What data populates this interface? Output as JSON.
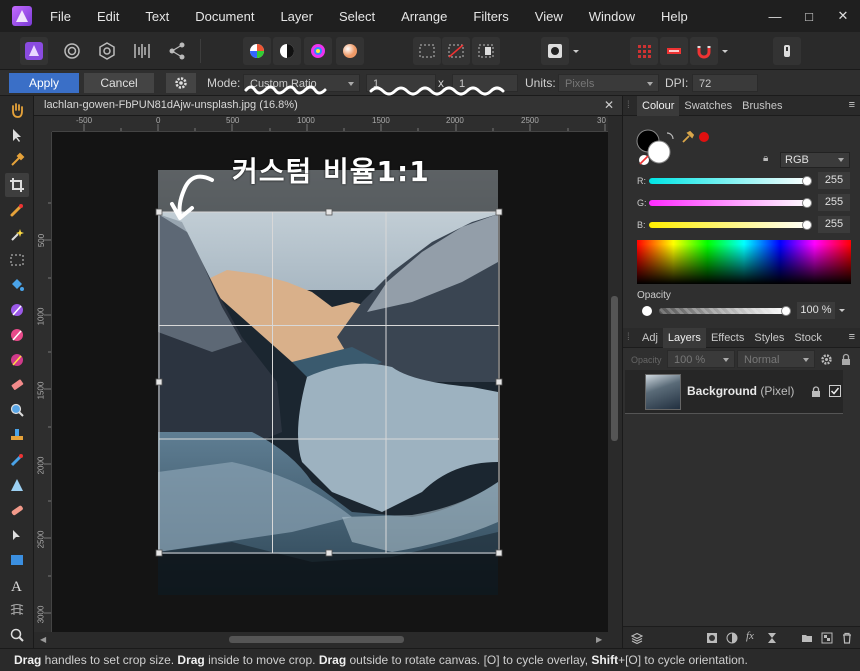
{
  "menu": [
    "File",
    "Edit",
    "Text",
    "Document",
    "Layer",
    "Select",
    "Arrange",
    "Filters",
    "View",
    "Window",
    "Help"
  ],
  "window_controls": {
    "minimize": "—",
    "restore": "□",
    "close": "✕"
  },
  "context": {
    "apply_label": "Apply",
    "cancel_label": "Cancel",
    "mode_label": "Mode:",
    "mode_value": "Custom Ratio",
    "ratio_w": "1",
    "ratio_x": "x",
    "ratio_h": "1",
    "units_label": "Units:",
    "units_value": "Pixels",
    "dpi_label": "DPI:",
    "dpi_value": "72"
  },
  "document": {
    "tab_title": "lachlan-gowen-FbPUN81dAjw-unsplash.jpg (16.8%)",
    "tab_close": "✕",
    "annotation": "커스텀 비율1:1",
    "ruler_h": [
      "-500",
      "0",
      "500",
      "1000",
      "1500",
      "2000",
      "2500",
      "30"
    ],
    "ruler_v": [
      "500",
      "1000",
      "1500",
      "2000",
      "2500",
      "3000"
    ]
  },
  "colour_panel": {
    "tabs": [
      "Colour",
      "Swatches",
      "Brushes"
    ],
    "model": "RGB",
    "channels": [
      {
        "label": "R:",
        "value": "255",
        "color": "#00e5ff"
      },
      {
        "label": "G:",
        "value": "255",
        "color": "#ff33ff"
      },
      {
        "label": "B:",
        "value": "255",
        "color": "#ffee00"
      }
    ],
    "opacity_label": "Opacity",
    "opacity_value": "100 %"
  },
  "layers_panel": {
    "tabs": [
      "Adj",
      "Layers",
      "Effects",
      "Styles",
      "Stock"
    ],
    "opacity_label": "Opacity",
    "opacity_value": "100 %",
    "blend_mode": "Normal",
    "layer_name": "Background",
    "layer_type": "(Pixel)"
  },
  "status": {
    "parts": [
      {
        "bold": "Drag",
        "text": " handles to set crop size. "
      },
      {
        "bold": "Drag",
        "text": " inside to move crop. "
      },
      {
        "bold": "Drag",
        "text": " outside to rotate canvas. [O] to cycle overlay, "
      },
      {
        "bold": "Shift",
        "text": "+[O] to cycle orientation."
      }
    ]
  },
  "colors": {
    "accent": "#3a6fc7",
    "background": "#2c2c2c",
    "primary_fill": "#000000",
    "secondary_fill": "#ffffff",
    "record_red": "#e01010"
  }
}
